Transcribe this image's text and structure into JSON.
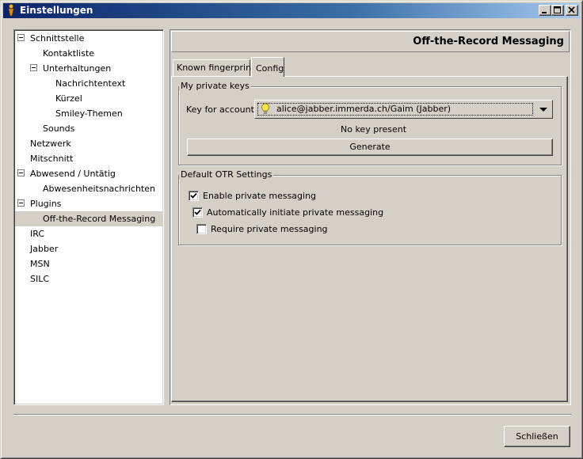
{
  "window": {
    "title": "Einstellungen",
    "controls": [
      "minimize-icon",
      "maximize-icon",
      "close-icon"
    ]
  },
  "tree": {
    "items": [
      {
        "label": "Schnittstelle",
        "expanded": true
      },
      {
        "label": "Kontaktliste"
      },
      {
        "label": "Unterhaltungen",
        "expanded": true
      },
      {
        "label": "Nachrichtentext"
      },
      {
        "label": "Kürzel"
      },
      {
        "label": "Smiley-Themen"
      },
      {
        "label": "Sounds"
      },
      {
        "label": "Netzwerk"
      },
      {
        "label": "Mitschnitt"
      },
      {
        "label": "Abwesend / Untätig",
        "expanded": true
      },
      {
        "label": "Abwesenheitsnachrichten"
      },
      {
        "label": "Plugins",
        "expanded": true
      },
      {
        "label": "Off-the-Record Messaging",
        "selected": true
      },
      {
        "label": "IRC"
      },
      {
        "label": "Jabber"
      },
      {
        "label": "MSN"
      },
      {
        "label": "SILC"
      }
    ]
  },
  "header": {
    "title": "Off-the-Record Messaging"
  },
  "tabs": [
    {
      "label": "Known fingerprints",
      "active": false
    },
    {
      "label": "Config",
      "active": true
    }
  ],
  "private_keys": {
    "group_label": "My private keys",
    "account_label": "Key for account:",
    "account_value": "alice@jabber.immerda.ch/Gaim (Jabber)",
    "account_icon": "lightbulb-icon",
    "status": "No key present",
    "generate_label": "Generate"
  },
  "otr_settings": {
    "group_label": "Default OTR Settings",
    "options": [
      {
        "label": "Enable private messaging",
        "checked": true
      },
      {
        "label": "Automatically initiate private messaging",
        "checked": true
      },
      {
        "label": "Require private messaging",
        "checked": false
      }
    ]
  },
  "footer": {
    "close_label": "Schließen"
  },
  "colors": {
    "title_gradient_start": "#0a246a",
    "title_gradient_end": "#a6caf0",
    "face": "#d4d0c8"
  }
}
